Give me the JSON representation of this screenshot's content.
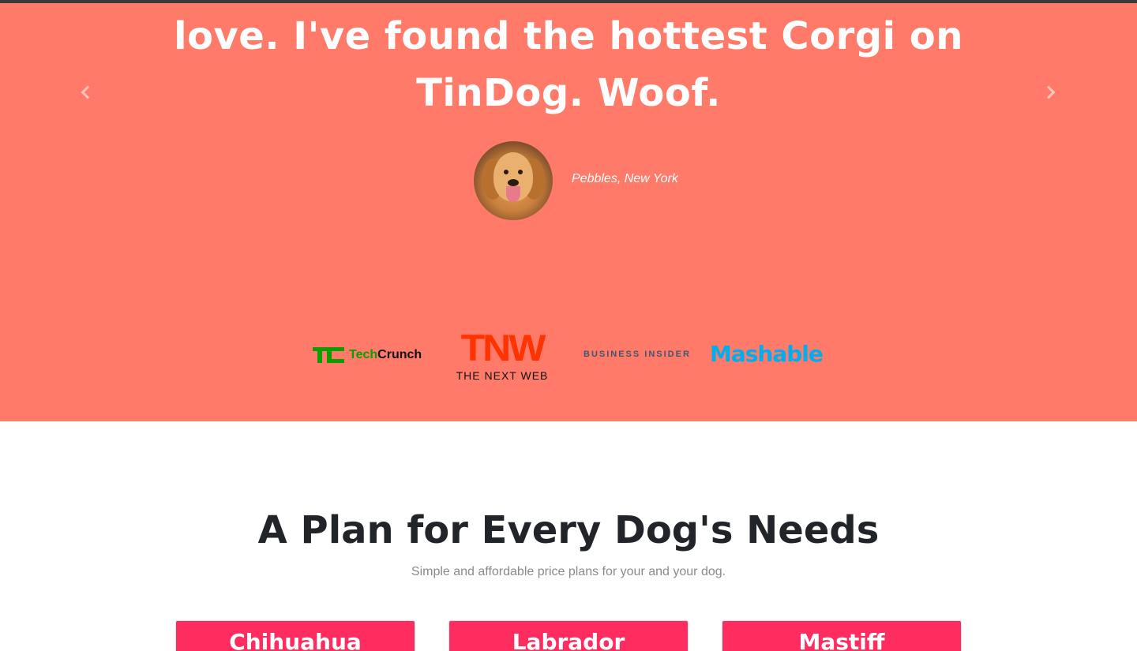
{
  "testimonial": {
    "quote": "love. I've found the hottest Corgi on TinDog. Woof.",
    "author": "Pebbles, New York",
    "avatar_icon": "dog-avatar-icon",
    "prev_icon": "chevron-left-icon",
    "next_icon": "chevron-right-icon",
    "background_color": "#ff7a69"
  },
  "press": {
    "techcrunch_mark": "TC",
    "techcrunch_text_a": "Tech",
    "techcrunch_text_b": "Crunch",
    "tnw_big": "TNW",
    "tnw_small": "THE NEXT WEB",
    "business_insider": "BUSINESS INSIDER",
    "mashable": "Mashable"
  },
  "pricing": {
    "title": "A Plan for Every Dog's Needs",
    "subtitle": "Simple and affordable price plans for your and your dog.",
    "plans": [
      {
        "name": "Chihuahua"
      },
      {
        "name": "Labrador"
      },
      {
        "name": "Mastiff"
      }
    ],
    "card_color": "#ff2d5f"
  }
}
